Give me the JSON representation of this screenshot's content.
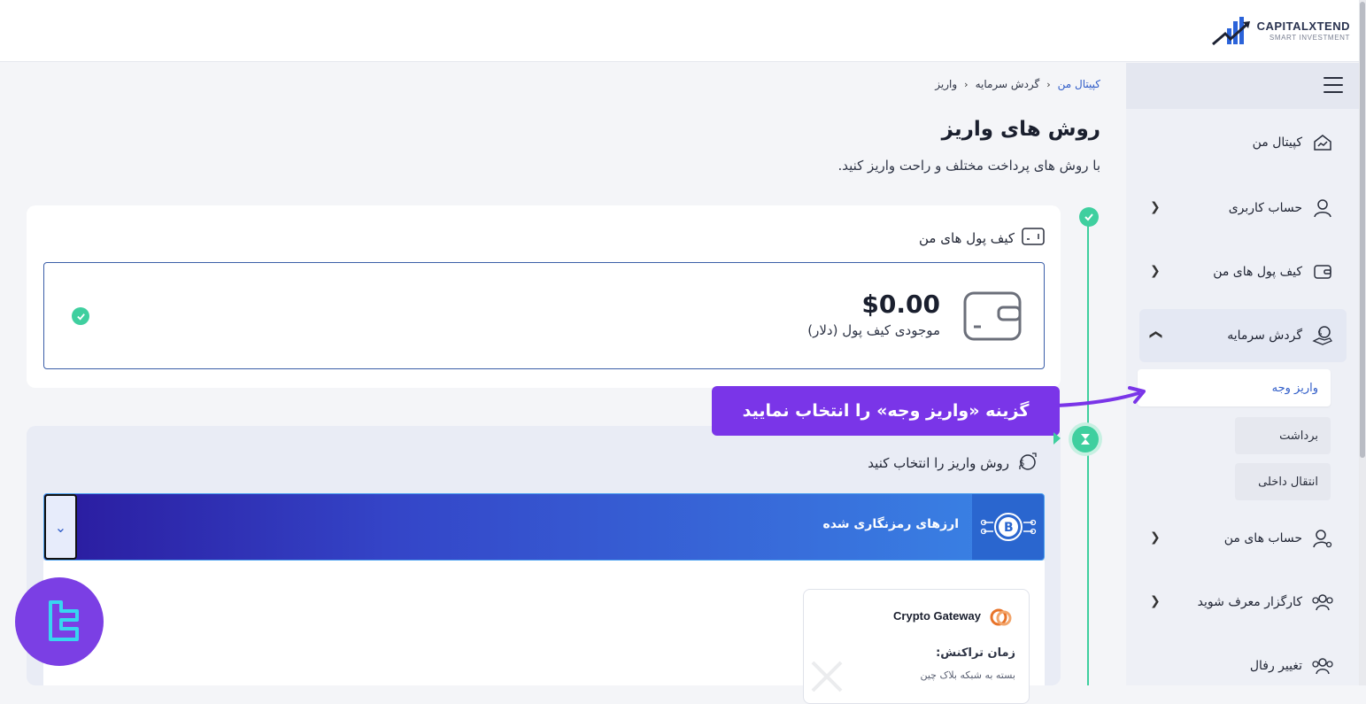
{
  "logo": {
    "name": "CAPITALXTEND",
    "tagline": "SMART INVESTMENT"
  },
  "breadcrumb": {
    "item1": "کپیتال من",
    "item2": "گردش سرمایه",
    "item3": "واریز"
  },
  "page": {
    "title": "روش های واریز",
    "subtitle": "با روش های پرداخت مختلف و راحت واریز کنید."
  },
  "wallets": {
    "title": "کیف پول های من",
    "balance": "$0.00",
    "balance_label": "موجودی کیف پول (دلار)"
  },
  "callout": {
    "text": "گزینه «واریز وجه» را انتخاب نمایید"
  },
  "methods": {
    "title": "روش واریز را انتخاب کنید",
    "accordion_label": "ارزهای رمزنگاری شده",
    "gateway": {
      "name": "Crypto Gateway",
      "time_label": "زمان تراکنش:",
      "time_value": "بسته به شبکه بلاک چین"
    }
  },
  "sidebar": {
    "items": [
      {
        "label": "کپیتال من",
        "icon": "home-chart-icon"
      },
      {
        "label": "حساب کاربری",
        "icon": "user-icon"
      },
      {
        "label": "کیف پول های من",
        "icon": "wallet-icon"
      },
      {
        "label": "گردش سرمایه",
        "icon": "money-hand-icon"
      },
      {
        "label": "حساب های من",
        "icon": "user-settings-icon"
      },
      {
        "label": "کارگزار معرف شوید",
        "icon": "users-icon"
      },
      {
        "label": "تغییر رفال",
        "icon": "users-icon"
      }
    ],
    "sub_items": [
      {
        "label": "واریز وجه"
      },
      {
        "label": "برداشت"
      },
      {
        "label": "انتقال داخلی"
      }
    ]
  },
  "colors": {
    "accent": "#2f5cc8",
    "timeline": "#3fcf9f",
    "callout": "#7a35e8",
    "badge": "#7b3fe4"
  }
}
